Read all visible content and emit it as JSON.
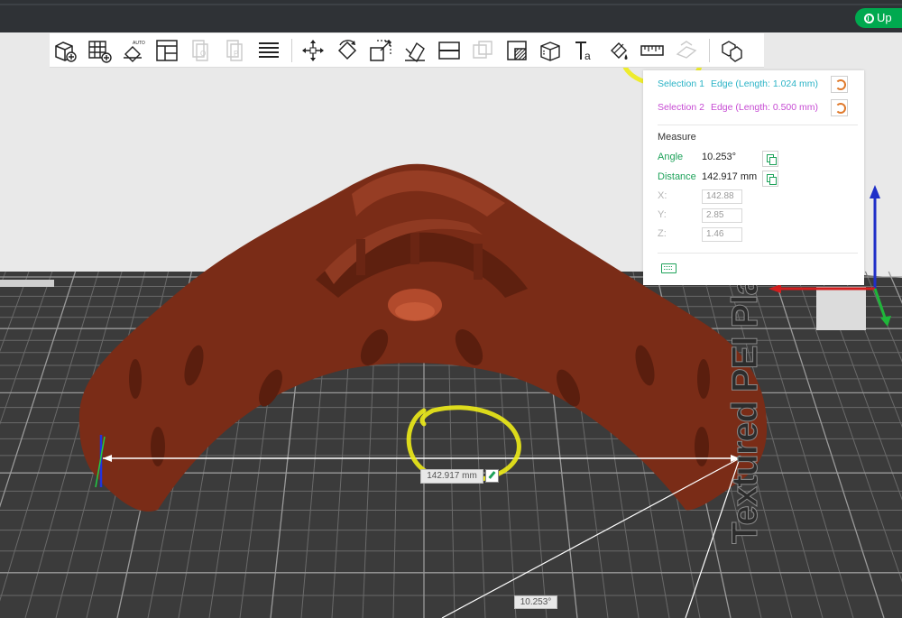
{
  "titlebar": {
    "upload_label": "Up"
  },
  "toolbar": {
    "left_tools": [
      "add-object-icon",
      "arrange-grid-icon",
      "auto-orient-icon",
      "layout-icon",
      "copy-disabled-icon",
      "paste-disabled-icon",
      "layers-icon"
    ],
    "right_tools": [
      "move-icon",
      "rotate-icon",
      "scale-icon",
      "lay-on-face-icon",
      "cut-icon",
      "boolean-disabled-icon",
      "support-paint-icon",
      "seam-paint-icon",
      "text-icon",
      "color-paint-icon",
      "measure-icon",
      "assembly-icon",
      "split-icon"
    ]
  },
  "measure": {
    "selection1": {
      "label": "Selection 1",
      "detail": "Edge (Length: 1.024 mm)",
      "color": "#2bb3c6"
    },
    "selection2": {
      "label": "Selection 2",
      "detail": "Edge (Length: 0.500 mm)",
      "color": "#c64bd3"
    },
    "title": "Measure",
    "angle": {
      "label": "Angle",
      "value": "10.253°"
    },
    "distance": {
      "label": "Distance",
      "value": "142.917 mm"
    },
    "x": {
      "label": "X:",
      "value": "142.88"
    },
    "y": {
      "label": "Y:",
      "value": "2.85"
    },
    "z": {
      "label": "Z:",
      "value": "1.46"
    }
  },
  "scene": {
    "distance_label": "142.917 mm",
    "angle_label": "10.253°",
    "plate_text": "Textured PEI Plate",
    "model_color": "#7a2c17",
    "annotation_color": "#f2ef1a"
  }
}
